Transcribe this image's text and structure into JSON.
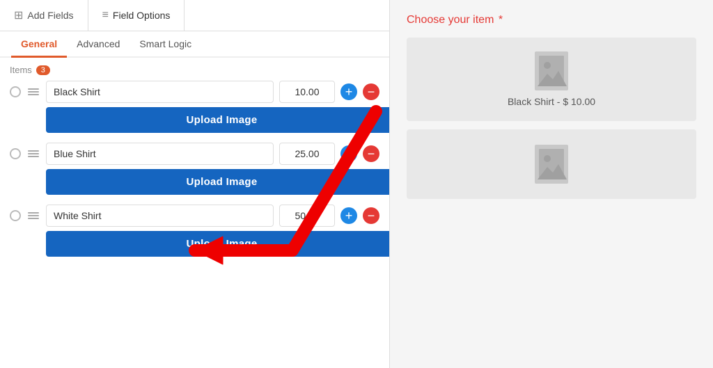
{
  "topTabs": [
    {
      "id": "add-fields",
      "label": "Add Fields",
      "icon": "⊞",
      "active": false
    },
    {
      "id": "field-options",
      "label": "Field Options",
      "icon": "≡",
      "active": true
    }
  ],
  "subTabs": [
    {
      "id": "general",
      "label": "General",
      "active": true
    },
    {
      "id": "advanced",
      "label": "Advanced",
      "active": false
    },
    {
      "id": "smart-logic",
      "label": "Smart Logic",
      "active": false
    }
  ],
  "itemsLabel": "Items",
  "itemsBadge": "3",
  "items": [
    {
      "id": "item-1",
      "name": "Black Shirt",
      "price": "10.00"
    },
    {
      "id": "item-2",
      "name": "Blue Shirt",
      "price": "25.00"
    },
    {
      "id": "item-3",
      "name": "White Shirt",
      "price": "50.00"
    }
  ],
  "uploadLabel": "Upload Image",
  "preview": {
    "title": "Choose your item",
    "required": "*",
    "items": [
      {
        "id": "p1",
        "label": "Black Shirt - $ 10.00"
      },
      {
        "id": "p2",
        "label": ""
      }
    ]
  }
}
